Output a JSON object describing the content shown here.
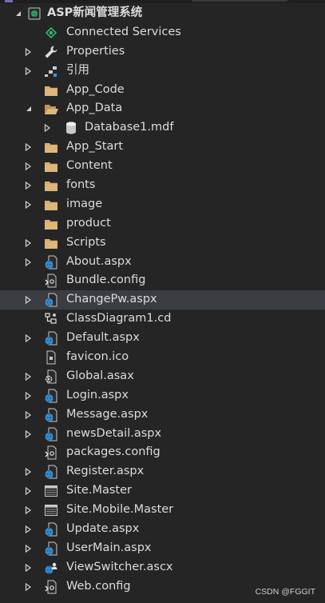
{
  "tree": {
    "items": [
      {
        "label": "ASP新闻管理系统",
        "icon": "web-project-icon",
        "depth": 0,
        "arrow": "expanded",
        "bold": true
      },
      {
        "label": "Connected Services",
        "icon": "connected-services-icon",
        "depth": 1,
        "arrow": "none"
      },
      {
        "label": "Properties",
        "icon": "wrench-icon",
        "depth": 1,
        "arrow": "collapsed"
      },
      {
        "label": "引用",
        "icon": "references-icon",
        "depth": 1,
        "arrow": "collapsed"
      },
      {
        "label": "App_Code",
        "icon": "folder-icon",
        "depth": 1,
        "arrow": "none"
      },
      {
        "label": "App_Data",
        "icon": "folder-open-icon",
        "depth": 1,
        "arrow": "expanded"
      },
      {
        "label": "Database1.mdf",
        "icon": "database-icon",
        "depth": 2,
        "arrow": "collapsed"
      },
      {
        "label": "App_Start",
        "icon": "folder-icon",
        "depth": 1,
        "arrow": "collapsed"
      },
      {
        "label": "Content",
        "icon": "folder-icon",
        "depth": 1,
        "arrow": "collapsed"
      },
      {
        "label": "fonts",
        "icon": "folder-icon",
        "depth": 1,
        "arrow": "collapsed"
      },
      {
        "label": "image",
        "icon": "folder-icon",
        "depth": 1,
        "arrow": "collapsed"
      },
      {
        "label": "product",
        "icon": "folder-icon",
        "depth": 1,
        "arrow": "none"
      },
      {
        "label": "Scripts",
        "icon": "folder-icon",
        "depth": 1,
        "arrow": "collapsed"
      },
      {
        "label": "About.aspx",
        "icon": "aspx-file-icon",
        "depth": 1,
        "arrow": "collapsed"
      },
      {
        "label": "Bundle.config",
        "icon": "config-file-icon",
        "depth": 1,
        "arrow": "none"
      },
      {
        "label": "ChangePw.aspx",
        "icon": "aspx-file-icon",
        "depth": 1,
        "arrow": "collapsed",
        "selected": true
      },
      {
        "label": "ClassDiagram1.cd",
        "icon": "class-diagram-icon",
        "depth": 1,
        "arrow": "none"
      },
      {
        "label": "Default.aspx",
        "icon": "aspx-file-icon",
        "depth": 1,
        "arrow": "collapsed"
      },
      {
        "label": "favicon.ico",
        "icon": "ico-file-icon",
        "depth": 1,
        "arrow": "none"
      },
      {
        "label": "Global.asax",
        "icon": "asax-file-icon",
        "depth": 1,
        "arrow": "collapsed"
      },
      {
        "label": "Login.aspx",
        "icon": "aspx-file-icon",
        "depth": 1,
        "arrow": "collapsed"
      },
      {
        "label": "Message.aspx",
        "icon": "aspx-file-icon",
        "depth": 1,
        "arrow": "collapsed"
      },
      {
        "label": "newsDetail.aspx",
        "icon": "aspx-file-icon",
        "depth": 1,
        "arrow": "collapsed"
      },
      {
        "label": "packages.config",
        "icon": "config-file-icon",
        "depth": 1,
        "arrow": "none"
      },
      {
        "label": "Register.aspx",
        "icon": "aspx-file-icon",
        "depth": 1,
        "arrow": "collapsed"
      },
      {
        "label": "Site.Master",
        "icon": "master-page-icon",
        "depth": 1,
        "arrow": "collapsed"
      },
      {
        "label": "Site.Mobile.Master",
        "icon": "master-page-icon",
        "depth": 1,
        "arrow": "collapsed"
      },
      {
        "label": "Update.aspx",
        "icon": "aspx-file-icon",
        "depth": 1,
        "arrow": "collapsed"
      },
      {
        "label": "UserMain.aspx",
        "icon": "aspx-file-icon",
        "depth": 1,
        "arrow": "collapsed"
      },
      {
        "label": "ViewSwitcher.ascx",
        "icon": "user-control-icon",
        "depth": 1,
        "arrow": "collapsed"
      },
      {
        "label": "Web.config",
        "icon": "config-file-icon",
        "depth": 1,
        "arrow": "collapsed"
      }
    ]
  },
  "watermark": "CSDN @FGGIT",
  "colors": {
    "background": "#252526",
    "selection": "#3a3d41",
    "text": "#dcdcdc",
    "folder": "#dcb67a",
    "web": "#3a96dd"
  }
}
